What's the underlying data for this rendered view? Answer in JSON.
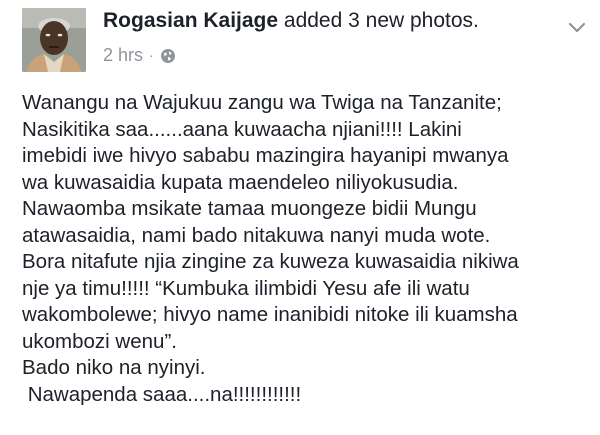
{
  "post": {
    "author": "Rogasian Kaijage",
    "action": " added 3 new photos.",
    "timestamp": "2 hrs",
    "separator": "·",
    "privacy_icon": "globe-icon",
    "menu_icon": "chevron-down-icon",
    "lines": [
      "Wanangu na Wajukuu zangu wa Twiga na Tanzanite;",
      "Nasikitika saa......aana kuwaacha njiani!!!! Lakini",
      "imebidi iwe hivyo sababu mazingira hayanipi mwanya",
      "wa kuwasaidia kupata maendeleo niliyokusudia.",
      "Nawaomba msikate tamaa muongeze bidii Mungu",
      "atawasaidia, nami bado nitakuwa nanyi muda wote.",
      "Bora nitafute njia zingine za kuweza kuwasaidia nikiwa",
      "nje ya timu!!!!! “Kumbuka ilimbidi Yesu afe ili watu",
      "wakombolewe; hivyo name inanibidi nitoke ili kuamsha",
      "ukombozi wenu”.",
      "Bado niko na nyinyi.",
      " Nawapenda saaa....na!!!!!!!!!!!!"
    ]
  },
  "colors": {
    "text": "#1d2129",
    "meta": "#90949c"
  }
}
